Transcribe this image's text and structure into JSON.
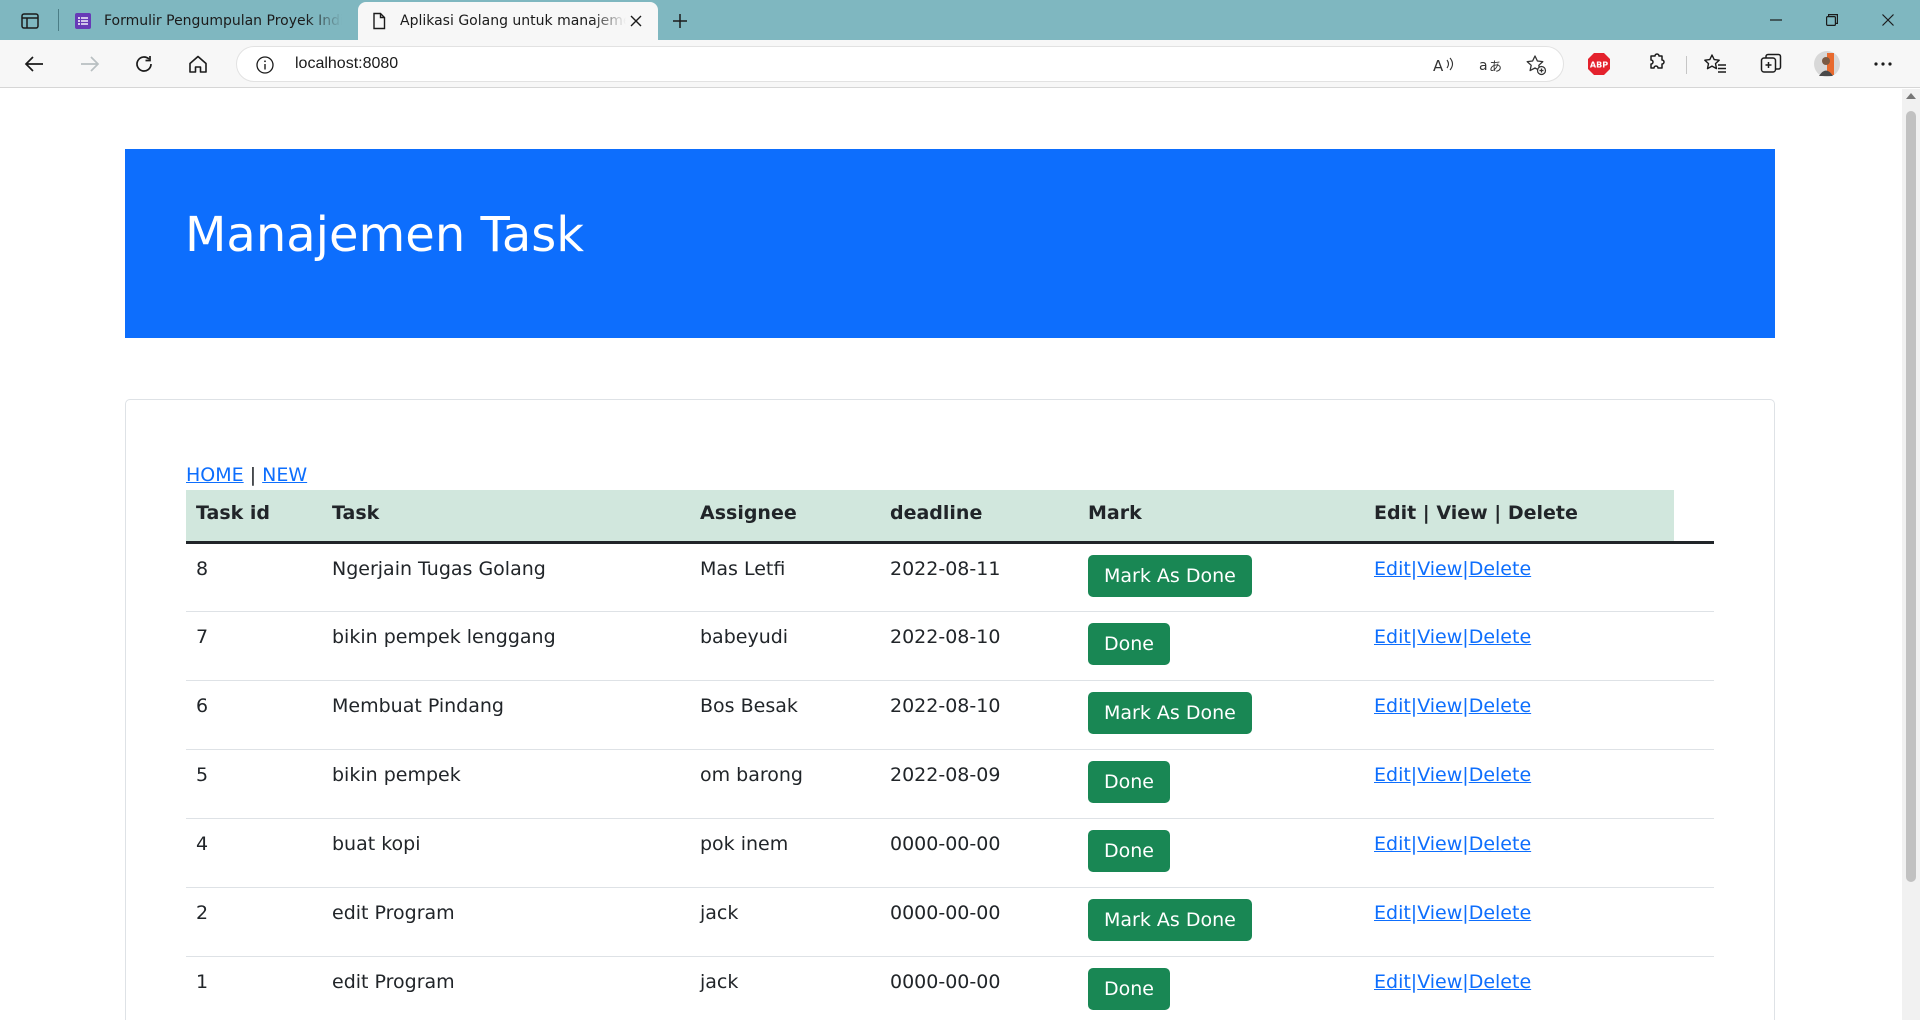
{
  "browser": {
    "tabs": [
      {
        "title": "Formulir Pengumpulan Proyek Individu",
        "active": false,
        "icon": "google-forms-icon"
      },
      {
        "title": "Aplikasi Golang untuk manajemen task",
        "active": true,
        "icon": "page-icon"
      }
    ],
    "address": "localhost:8080",
    "colors": {
      "tabbar": "#7fb7c0",
      "toolbar": "#f7f7f7"
    }
  },
  "page": {
    "title": "Manajemen Task",
    "nav": {
      "home": "HOME",
      "separator": "|",
      "new": "NEW"
    },
    "table": {
      "headers": [
        "Task id",
        "Task",
        "Assignee",
        "deadline",
        "Mark",
        "Edit | View | Delete"
      ],
      "rows": [
        {
          "id": "8",
          "task": "Ngerjain Tugas Golang",
          "assignee": "Mas Letfi",
          "deadline": "2022-08-11",
          "mark": "Mark As Done"
        },
        {
          "id": "7",
          "task": "bikin pempek lenggang",
          "assignee": "babeyudi",
          "deadline": "2022-08-10",
          "mark": "Done"
        },
        {
          "id": "6",
          "task": "Membuat Pindang",
          "assignee": "Bos Besak",
          "deadline": "2022-08-10",
          "mark": "Mark As Done"
        },
        {
          "id": "5",
          "task": "bikin pempek",
          "assignee": "om barong",
          "deadline": "2022-08-09",
          "mark": "Done"
        },
        {
          "id": "4",
          "task": "buat kopi",
          "assignee": "pok inem",
          "deadline": "0000-00-00",
          "mark": "Done"
        },
        {
          "id": "2",
          "task": "edit Program",
          "assignee": "jack",
          "deadline": "0000-00-00",
          "mark": "Mark As Done"
        },
        {
          "id": "1",
          "task": "edit Program",
          "assignee": "jack",
          "deadline": "0000-00-00",
          "mark": "Done"
        }
      ],
      "actions": {
        "edit": "Edit",
        "view": "View",
        "delete": "Delete",
        "separator": "|"
      }
    },
    "colors": {
      "jumbotron": "#0d6efd",
      "button": "#198754",
      "header_shade": "#d1e7dd",
      "link": "#0d6efd"
    }
  }
}
